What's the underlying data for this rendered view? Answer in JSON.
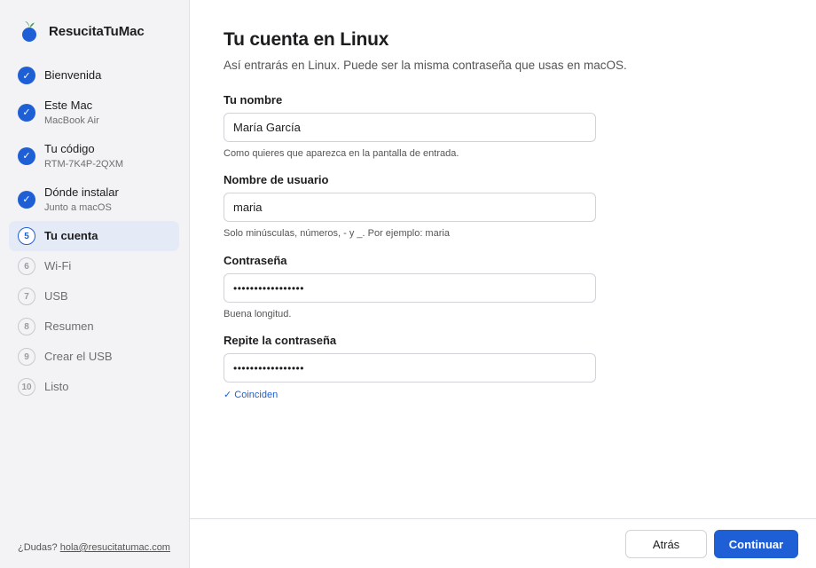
{
  "app": {
    "name": "ResucitaTuMac",
    "colors": {
      "accent": "#1f5fd6",
      "sidebar_bg": "#f3f3f5",
      "logo_leaf": "#3aa04a"
    }
  },
  "sidebar": {
    "steps": [
      {
        "number": "1",
        "label": "Bienvenida",
        "sub": "",
        "state": "done"
      },
      {
        "number": "2",
        "label": "Este Mac",
        "sub": "MacBook Air",
        "state": "done"
      },
      {
        "number": "3",
        "label": "Tu código",
        "sub": "RTM-7K4P-2QXM",
        "state": "done"
      },
      {
        "number": "4",
        "label": "Dónde instalar",
        "sub": "Junto a macOS",
        "state": "done"
      },
      {
        "number": "5",
        "label": "Tu cuenta",
        "sub": "",
        "state": "active"
      },
      {
        "number": "6",
        "label": "Wi-Fi",
        "sub": "",
        "state": "todo"
      },
      {
        "number": "7",
        "label": "USB",
        "sub": "",
        "state": "todo"
      },
      {
        "number": "8",
        "label": "Resumen",
        "sub": "",
        "state": "todo"
      },
      {
        "number": "9",
        "label": "Crear el USB",
        "sub": "",
        "state": "todo"
      },
      {
        "number": "10",
        "label": "Listo",
        "sub": "",
        "state": "todo"
      }
    ],
    "done_mark": "✓",
    "help_prefix": "¿Dudas?",
    "help_email": "hola@resucitatumac.com"
  },
  "main": {
    "title": "Tu cuenta en Linux",
    "subtitle": "Así entrarás en Linux. Puede ser la misma contraseña que usas en macOS.",
    "fields": {
      "name": {
        "label": "Tu nombre",
        "value": "María García",
        "hint": "Como quieres que aparezca en la pantalla de entrada."
      },
      "username": {
        "label": "Nombre de usuario",
        "value": "maria",
        "hint": "Solo minúsculas, números, - y _. Por ejemplo: maria"
      },
      "password": {
        "label": "Contraseña",
        "value": "•••••••••••••••••",
        "hint": "Buena longitud."
      },
      "password_repeat": {
        "label": "Repite la contraseña",
        "value": "•••••••••••••••••",
        "hint": "✓ Coinciden"
      }
    }
  },
  "footer": {
    "back_label": "Atrás",
    "next_label": "Continuar"
  }
}
